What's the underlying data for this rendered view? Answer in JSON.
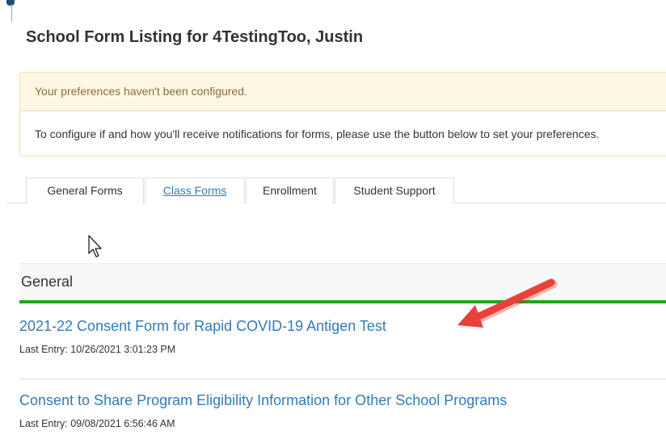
{
  "page": {
    "title": "School Form Listing for 4TestingToo, Justin"
  },
  "notice": {
    "heading": "Your preferences haven't been configured.",
    "body": "To configure if and how you'll receive notifications for forms, please use the button below to set your preferences."
  },
  "tabs": [
    {
      "label": "General Forms",
      "active": true
    },
    {
      "label": "Class Forms",
      "active": false
    },
    {
      "label": "Enrollment",
      "active": false
    },
    {
      "label": "Student Support",
      "active": false
    }
  ],
  "section": {
    "title": "General"
  },
  "forms": [
    {
      "title": "2021-22 Consent Form for Rapid COVID-19 Antigen Test",
      "last_entry": "Last Entry: 10/26/2021 3:01:23 PM"
    },
    {
      "title": "Consent to Share Program Eligibility Information for Other School Programs",
      "last_entry": "Last Entry: 09/08/2021 6:56:46 AM"
    }
  ],
  "colors": {
    "link": "#337ab7",
    "section_rule": "#20a520",
    "notice_bg": "#fcf8e3",
    "notice_text": "#8a6d3b",
    "annotation_arrow": "#e8413a"
  },
  "icons": {
    "cursor": "mouse-pointer-icon",
    "annotation": "red-arrow-annotation"
  }
}
